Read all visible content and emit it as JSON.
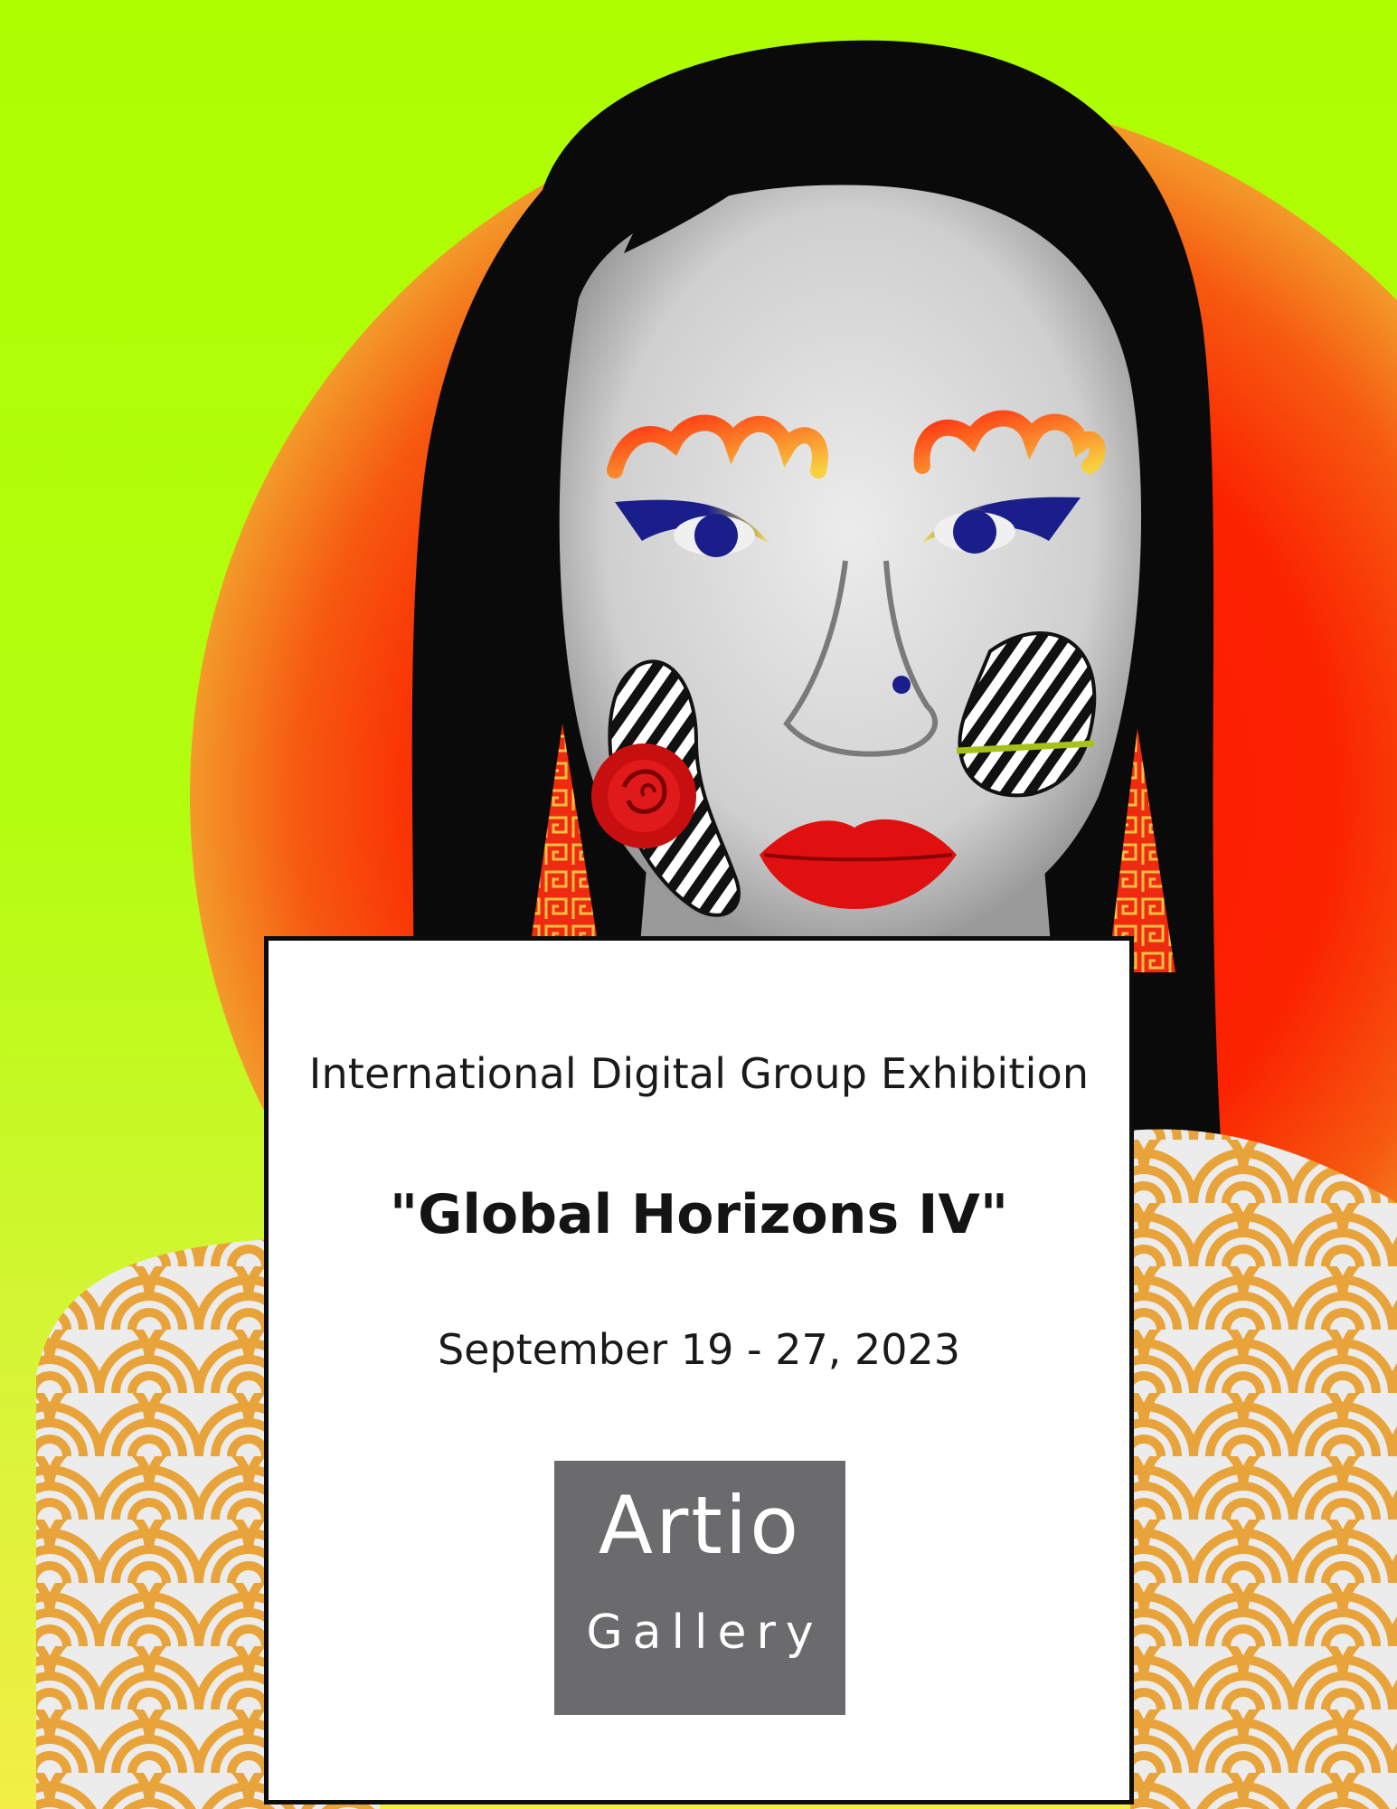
{
  "poster": {
    "exhibition_type": "International Digital Group Exhibition",
    "title": "\"Global Horizons IV\"",
    "dates": "September 19 - 27, 2023",
    "gallery_logo": {
      "word": "Artio",
      "sub": "Gallery"
    }
  },
  "colors": {
    "background_top": "#aefe00",
    "background_bottom": "#f2ee45",
    "sun": "#f81800",
    "logo_box": "#6b6b6d",
    "lip_red": "#e01010",
    "eye_blue": "#1a1e8a",
    "accent_yellow": "#f5e04a",
    "wave_orange": "#e8a43a"
  },
  "artwork": {
    "subject": "portrait-with-decorative-face-paint",
    "icons": [
      "sun-circle",
      "rose-icon",
      "wave-pattern",
      "greek-key-earring"
    ]
  }
}
